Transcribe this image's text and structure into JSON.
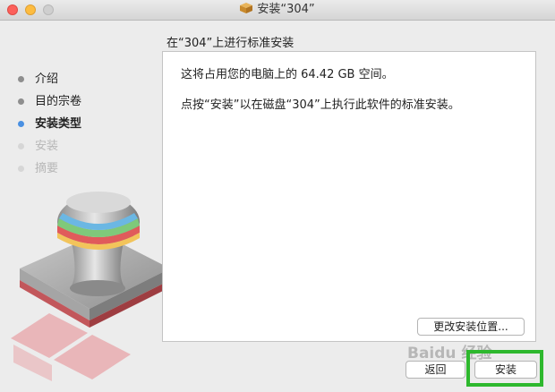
{
  "window": {
    "title": "安装“304”"
  },
  "heading": "在“304”上进行标准安装",
  "steps": [
    {
      "label": "介绍",
      "state": "done"
    },
    {
      "label": "目的宗卷",
      "state": "done"
    },
    {
      "label": "安装类型",
      "state": "current"
    },
    {
      "label": "安装",
      "state": "future"
    },
    {
      "label": "摘要",
      "state": "future"
    }
  ],
  "content": {
    "space_text": "这将占用您的电脑上的 64.42 GB 空间。",
    "instruction_text": "点按“安装”以在磁盘“304”上执行此软件的标准安装。"
  },
  "buttons": {
    "change_location": "更改安装位置...",
    "back": "返回",
    "install": "安装"
  },
  "watermark": "Baidu 经验",
  "colors": {
    "current_step": "#4a90e2",
    "highlight": "#2eb82e"
  }
}
